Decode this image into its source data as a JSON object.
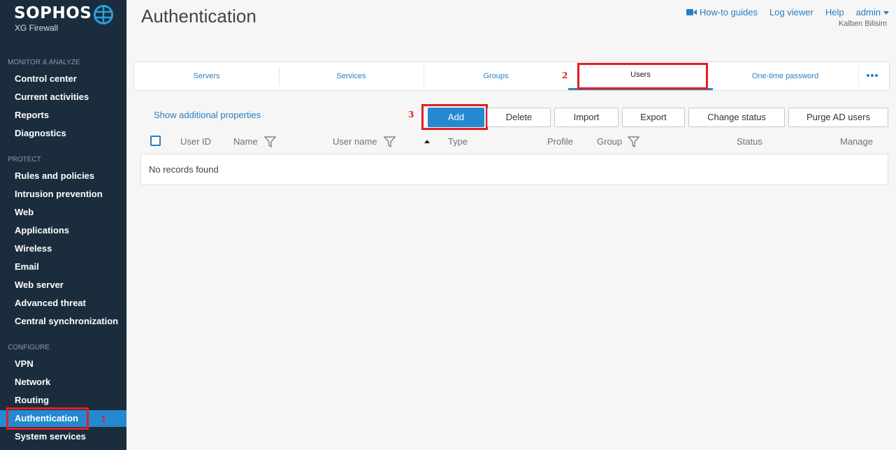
{
  "brand": {
    "name": "SOPHOS",
    "product": "XG Firewall"
  },
  "sidebar": {
    "sections": [
      {
        "title": "MONITOR & ANALYZE",
        "items": [
          "Control center",
          "Current activities",
          "Reports",
          "Diagnostics"
        ]
      },
      {
        "title": "PROTECT",
        "items": [
          "Rules and policies",
          "Intrusion prevention",
          "Web",
          "Applications",
          "Wireless",
          "Email",
          "Web server",
          "Advanced threat",
          "Central synchronization"
        ]
      },
      {
        "title": "CONFIGURE",
        "items": [
          "VPN",
          "Network",
          "Routing",
          "Authentication",
          "System services"
        ]
      }
    ],
    "active_item": "Authentication"
  },
  "header": {
    "title": "Authentication",
    "links": {
      "howto": "How-to guides",
      "log_viewer": "Log viewer",
      "help": "Help",
      "user": "admin"
    },
    "org": "Kalben Bilisim"
  },
  "tabs": [
    "Servers",
    "Services",
    "Groups",
    "Users",
    "One-time password"
  ],
  "active_tab": "Users",
  "toolbar": {
    "show_props": "Show additional properties",
    "buttons": [
      "Add",
      "Delete",
      "Import",
      "Export",
      "Change status",
      "Purge AD users"
    ]
  },
  "table": {
    "columns": [
      "User ID",
      "Name",
      "User name",
      "Type",
      "Profile",
      "Group",
      "Status",
      "Manage"
    ],
    "empty_text": "No records found"
  },
  "annotations": [
    "1",
    "2",
    "3"
  ],
  "colors": {
    "sidebar_bg": "#1b2d3d",
    "accent": "#2489d0",
    "highlight": "#e31e24"
  }
}
